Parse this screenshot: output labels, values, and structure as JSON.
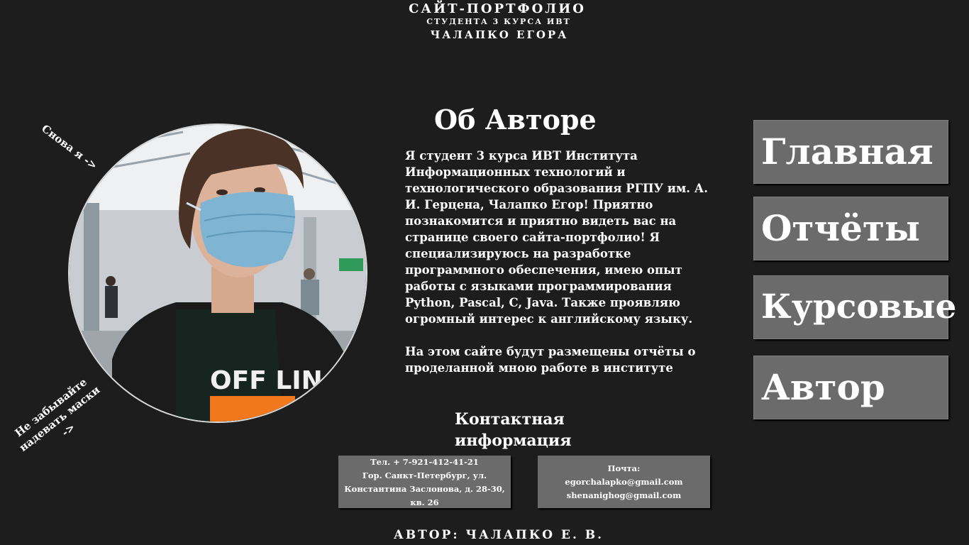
{
  "header": {
    "line1": "САЙТ-ПОРТФОЛИО",
    "line2": "СТУДЕНТА 3 КУРСА ИВТ",
    "line3": "ЧАЛАПКО ЕГОРА"
  },
  "photo": {
    "notes": {
      "top": "Снова я ->",
      "bottom": "Не забывайте надевать маски ->"
    }
  },
  "about": {
    "title": "Об Авторе",
    "paragraph1": "Я студент 3 курса ИВТ Института Информационных технологий и технологического образования РГПУ им. А. И. Герцена, Чалапко Егор! Приятно познакомится и приятно видеть вас на странице своего сайта-портфолио! Я специализируюсь на разработке программного обеспечения, имею опыт работы с языками программирования Python, Pascal, C, Java. Также проявляю огромный интерес к английскому языку.",
    "paragraph2": "На этом сайте будут размещены отчёты о проделанной мною работе в институте"
  },
  "contacts": {
    "title": "Контактная информация",
    "phone": "Тел. + 7-921-412-41-21",
    "address": "Гор. Санкт-Петербург, ул. Константина Заслонова, д. 28-30, кв. 26",
    "mail_label": "Почта:",
    "email1": "egorchalapko@gmail.com",
    "email2": "shenanighog@gmail.com"
  },
  "nav": {
    "main": "Главная",
    "reports": "Отчёты",
    "courses": "Курсовые",
    "author": "Автор"
  },
  "footer": {
    "text": "АВТОР: ЧАЛАПКО Е. В."
  },
  "colors": {
    "background": "#1d1d1d",
    "button": "#6b6b6b",
    "text": "#ffffff"
  }
}
